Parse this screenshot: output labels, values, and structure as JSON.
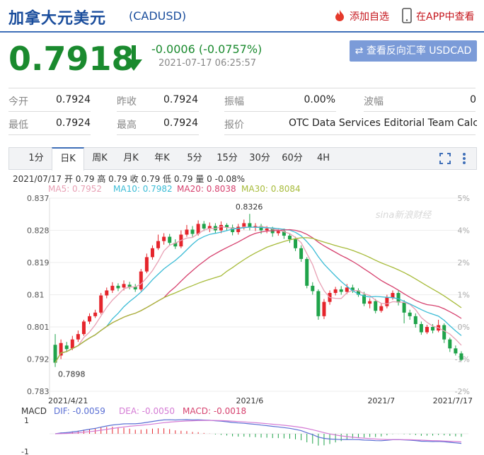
{
  "header": {
    "title": "加拿大元美元",
    "code": "(CADUSD)",
    "add_fav": "添加自选",
    "app_view": "在APP中查看"
  },
  "quote": {
    "price": "0.7918",
    "change": "-0.0006 (-0.0757%)",
    "timestamp": "2021-07-17 06:25:57",
    "reverse_button": "查看反向汇率 USDCAD"
  },
  "stats": {
    "open_label": "今开",
    "open": "0.7924",
    "prev_label": "昨收",
    "prev": "0.7924",
    "amp_label": "振幅",
    "amp": "0.00%",
    "wave_label": "波幅",
    "wave": "0",
    "low_label": "最低",
    "low": "0.7924",
    "high_label": "最高",
    "high": "0.7924",
    "src_label": "报价",
    "src": "OTC Data Services Editorial Team Calc..."
  },
  "tabs": [
    "1分",
    "日K",
    "周K",
    "月K",
    "年K",
    "5分",
    "15分",
    "30分",
    "60分",
    "4H"
  ],
  "active_tab": "日K",
  "ohlc_line": "2021/07/17 开 0.79 高 0.79 收 0.79 低 0.79 量 0 -0.08%",
  "ma_line": {
    "ma5": "MA5: 0.7952",
    "ma10": "MA10: 0.7982",
    "ma20": "MA20: 0.8038",
    "ma30": "MA30: 0.8084"
  },
  "macd_line": {
    "label": "MACD",
    "dif": "DIF: -0.0059",
    "dea": "DEA: -0.0050",
    "macd": "MACD: -0.0018"
  },
  "colors": {
    "up": "#e5252c",
    "down": "#1fa34a",
    "ma5": "#e8a0b4",
    "ma10": "#3cbcd6",
    "ma20": "#d6416e",
    "ma30": "#a7bb3a",
    "dif": "#5a6fd4",
    "dea": "#d47ad4"
  },
  "chart_data": {
    "type": "candlestick",
    "ylim": [
      0.783,
      0.837
    ],
    "y_ticks": [
      "0.837",
      "0.828",
      "0.819",
      "0.81",
      "0.801",
      "0.792",
      "0.783"
    ],
    "pct_ticks": [
      "5%",
      "4%",
      "2%",
      "1%",
      "0%",
      "-1%",
      "-2%"
    ],
    "x_ticks": [
      "2021/4/21",
      "2021/6",
      "2021/7",
      "2021/7/17"
    ],
    "annotations": {
      "high": "0.8326",
      "low": "0.7898"
    },
    "watermark": "sina新浪财经",
    "candles": [
      [
        0.796,
        0.791,
        0.799,
        0.7898
      ],
      [
        0.793,
        0.7965,
        0.7975,
        0.792
      ],
      [
        0.7958,
        0.7948,
        0.7968,
        0.794
      ],
      [
        0.795,
        0.7975,
        0.7985,
        0.7945
      ],
      [
        0.7975,
        0.799,
        0.8,
        0.7968
      ],
      [
        0.799,
        0.8025,
        0.803,
        0.7985
      ],
      [
        0.8025,
        0.804,
        0.8048,
        0.8018
      ],
      [
        0.804,
        0.805,
        0.8058,
        0.8035
      ],
      [
        0.805,
        0.8098,
        0.8105,
        0.8045
      ],
      [
        0.8098,
        0.8112,
        0.812,
        0.809
      ],
      [
        0.8112,
        0.8125,
        0.8135,
        0.8105
      ],
      [
        0.8125,
        0.8118,
        0.8132,
        0.811
      ],
      [
        0.812,
        0.813,
        0.814,
        0.8112
      ],
      [
        0.8128,
        0.8122,
        0.8136,
        0.8115
      ],
      [
        0.8122,
        0.8115,
        0.813,
        0.8108
      ],
      [
        0.8115,
        0.8165,
        0.8172,
        0.811
      ],
      [
        0.8165,
        0.8205,
        0.8215,
        0.816
      ],
      [
        0.8205,
        0.823,
        0.8238,
        0.8198
      ],
      [
        0.823,
        0.825,
        0.8268,
        0.8225
      ],
      [
        0.825,
        0.8262,
        0.8272,
        0.824
      ],
      [
        0.8262,
        0.8245,
        0.827,
        0.8238
      ],
      [
        0.8245,
        0.8235,
        0.8255,
        0.8228
      ],
      [
        0.8235,
        0.8268,
        0.828,
        0.823
      ],
      [
        0.8268,
        0.8282,
        0.8295,
        0.8262
      ],
      [
        0.8282,
        0.827,
        0.8292,
        0.8262
      ],
      [
        0.827,
        0.8298,
        0.8308,
        0.8265
      ],
      [
        0.8298,
        0.8285,
        0.8306,
        0.8278
      ],
      [
        0.8285,
        0.8292,
        0.8302,
        0.8275
      ],
      [
        0.8292,
        0.828,
        0.83,
        0.8272
      ],
      [
        0.828,
        0.8295,
        0.8305,
        0.8272
      ],
      [
        0.8295,
        0.8288,
        0.83,
        0.8278
      ],
      [
        0.8288,
        0.8275,
        0.8296,
        0.8266
      ],
      [
        0.8275,
        0.829,
        0.8298,
        0.8268
      ],
      [
        0.829,
        0.83,
        0.831,
        0.8282
      ],
      [
        0.83,
        0.8288,
        0.8326,
        0.828
      ],
      [
        0.8288,
        0.8292,
        0.83,
        0.8278
      ],
      [
        0.8292,
        0.828,
        0.8298,
        0.827
      ],
      [
        0.828,
        0.8285,
        0.8292,
        0.8272
      ],
      [
        0.8285,
        0.8272,
        0.829,
        0.8262
      ],
      [
        0.8272,
        0.8278,
        0.8286,
        0.8265
      ],
      [
        0.8278,
        0.8265,
        0.8285,
        0.8256
      ],
      [
        0.8265,
        0.8255,
        0.8272,
        0.8245
      ],
      [
        0.8255,
        0.823,
        0.8262,
        0.8222
      ],
      [
        0.823,
        0.82,
        0.8238,
        0.8192
      ],
      [
        0.82,
        0.8125,
        0.8205,
        0.8118
      ],
      [
        0.8125,
        0.811,
        0.8135,
        0.81
      ],
      [
        0.811,
        0.804,
        0.8115,
        0.803
      ],
      [
        0.804,
        0.808,
        0.8088,
        0.8032
      ],
      [
        0.808,
        0.8105,
        0.8112,
        0.8072
      ],
      [
        0.8105,
        0.8115,
        0.8122,
        0.8098
      ],
      [
        0.8115,
        0.8108,
        0.8124,
        0.81
      ],
      [
        0.8108,
        0.812,
        0.813,
        0.8102
      ],
      [
        0.812,
        0.8112,
        0.8128,
        0.8105
      ],
      [
        0.8112,
        0.81,
        0.8118,
        0.8094
      ],
      [
        0.81,
        0.8075,
        0.8108,
        0.8068
      ],
      [
        0.8075,
        0.8082,
        0.809,
        0.8062
      ],
      [
        0.8082,
        0.8055,
        0.8088,
        0.8048
      ],
      [
        0.8055,
        0.8068,
        0.8075,
        0.805
      ],
      [
        0.8068,
        0.8092,
        0.81,
        0.8062
      ],
      [
        0.8092,
        0.8105,
        0.8112,
        0.8086
      ],
      [
        0.8105,
        0.8078,
        0.8112,
        0.807
      ],
      [
        0.8078,
        0.805,
        0.8085,
        0.802
      ],
      [
        0.805,
        0.804,
        0.8058,
        0.803
      ],
      [
        0.804,
        0.8018,
        0.8048,
        0.8008
      ],
      [
        0.8018,
        0.7995,
        0.8025,
        0.7988
      ],
      [
        0.7995,
        0.801,
        0.8016,
        0.799
      ],
      [
        0.801,
        0.8,
        0.8018,
        0.7992
      ],
      [
        0.8,
        0.8015,
        0.803,
        0.7995
      ],
      [
        0.8015,
        0.7975,
        0.802,
        0.7965
      ],
      [
        0.7975,
        0.795,
        0.798,
        0.794
      ],
      [
        0.795,
        0.7936,
        0.7958,
        0.793
      ],
      [
        0.7936,
        0.7918,
        0.7942,
        0.7915
      ]
    ]
  }
}
